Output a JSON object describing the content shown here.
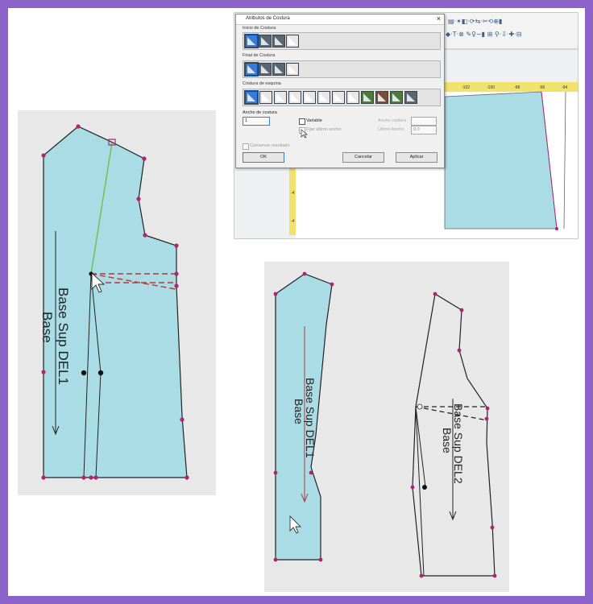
{
  "colors": {
    "border": "#8a62c8",
    "pattern_fill": "#aadce6",
    "point": "#b0246e",
    "panel_bg": "#e8e8e8"
  },
  "dialog": {
    "title": "Atributos de Costura",
    "close": "×",
    "section_start": "Inicio de Costura",
    "section_end": "Final de Costura",
    "section_corner": "Costura de esquina",
    "seam_width_label": "Ancho de costura",
    "seam_width_value": "1",
    "variable_label": "Variable",
    "fix_last_width_label": "Fijar último ancho",
    "seam_width_right_label": "Ancho costura",
    "last_width_label": "Último Ancho",
    "last_width_value": "0.0",
    "keep_result_label": "Conservar resultado",
    "ok_label": "OK",
    "cancel_label": "Cancelar",
    "apply_label": "Aplicar"
  },
  "ruler_numbers": [
    "-102",
    "-100",
    "-98",
    "-96",
    "-94"
  ],
  "ruler_left_numbers": [
    "-4",
    "-4"
  ],
  "patterns": {
    "left": {
      "line1": "Base Sup DEL1",
      "line2": "Base"
    },
    "bottom_left": {
      "line1": "Base Sup DEL1",
      "line2": "Base"
    },
    "bottom_right": {
      "line1": "Base Sup DEL2",
      "line2": "Base"
    }
  }
}
